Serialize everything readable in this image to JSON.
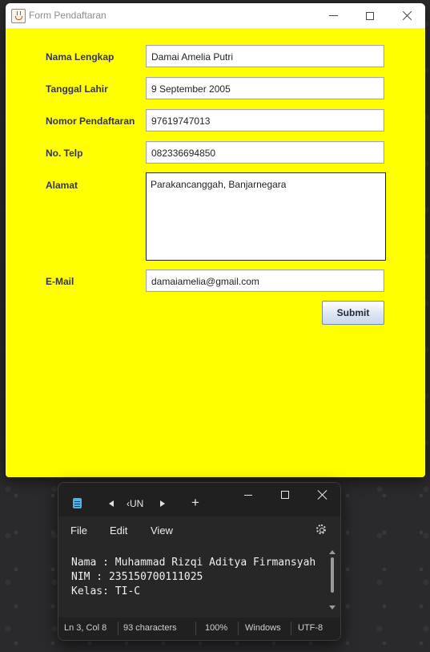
{
  "form_window": {
    "title": "Form Pendaftaran",
    "background": "#ffff00",
    "fields": {
      "nama": {
        "label": "Nama Lengkap",
        "value": "Damai Amelia Putri"
      },
      "tanggal": {
        "label": "Tanggal Lahir",
        "value": "9 September 2005"
      },
      "nomor": {
        "label": "Nomor Pendaftaran",
        "value": "97619747013"
      },
      "telp": {
        "label": "No. Telp",
        "value": "082336694850"
      },
      "alamat": {
        "label": "Alamat",
        "value": "Parakancanggah, Banjarnegara"
      },
      "email": {
        "label": "E-Mail",
        "value": "damaiamelia@gmail.com"
      }
    },
    "submit_label": "Submit"
  },
  "notepad": {
    "tab_label": "‹UN",
    "new_tab": "+",
    "menu": {
      "file": "File",
      "edit": "Edit",
      "view": "View"
    },
    "lines": [
      "Nama : Muhammad Rizqi Aditya Firmansyah",
      "NIM : 235150700111025",
      "Kelas: TI-C"
    ],
    "status": {
      "position": "Ln 3, Col 8",
      "characters": "93 characters",
      "zoom": "100%",
      "line_ending": "Windows",
      "encoding": "UTF-8"
    }
  }
}
